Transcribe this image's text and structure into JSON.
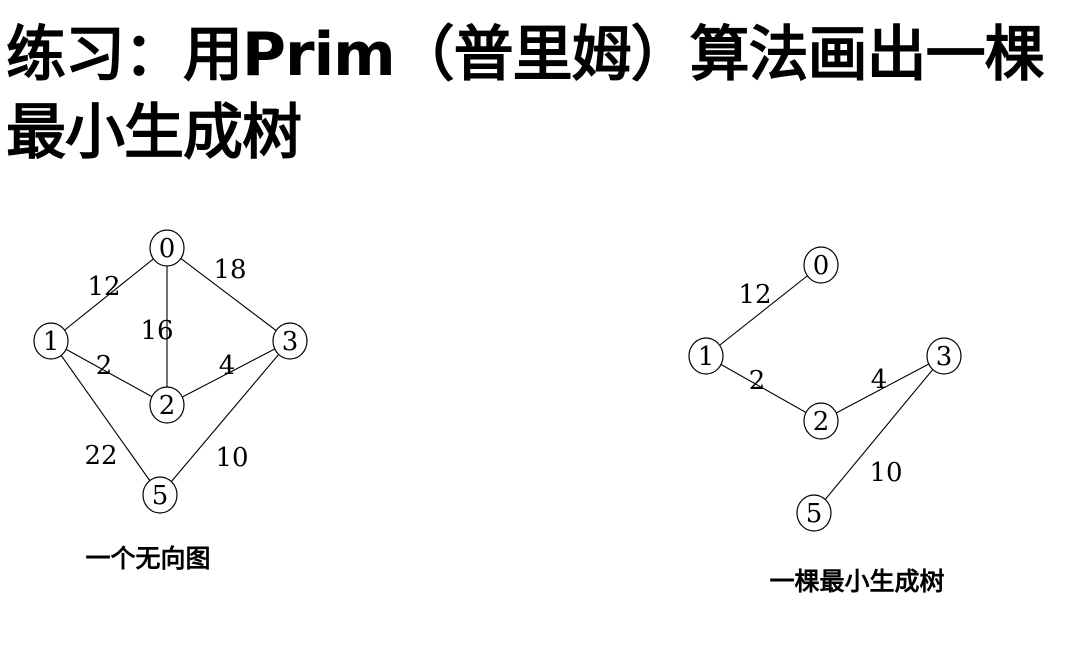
{
  "title": "练习：用Prim（普里姆）算法画出一棵最小生成树",
  "graph": {
    "caption": "一个无向图",
    "nodes": [
      "0",
      "1",
      "2",
      "3",
      "5"
    ],
    "edges": [
      {
        "from": "0",
        "to": "1",
        "weight": "12"
      },
      {
        "from": "0",
        "to": "3",
        "weight": "18"
      },
      {
        "from": "0",
        "to": "2",
        "weight": "16"
      },
      {
        "from": "1",
        "to": "2",
        "weight": "2"
      },
      {
        "from": "2",
        "to": "3",
        "weight": "4"
      },
      {
        "from": "1",
        "to": "5",
        "weight": "22"
      },
      {
        "from": "3",
        "to": "5",
        "weight": "10"
      }
    ]
  },
  "tree": {
    "caption": "一棵最小生成树",
    "nodes": [
      "0",
      "1",
      "2",
      "3",
      "5"
    ],
    "edges": [
      {
        "from": "0",
        "to": "1",
        "weight": "12"
      },
      {
        "from": "1",
        "to": "2",
        "weight": "2"
      },
      {
        "from": "2",
        "to": "3",
        "weight": "4"
      },
      {
        "from": "3",
        "to": "5",
        "weight": "10"
      }
    ]
  }
}
